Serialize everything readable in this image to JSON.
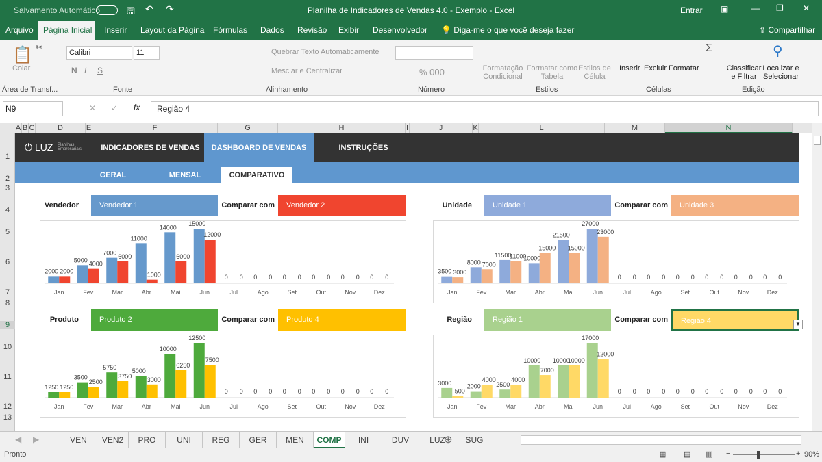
{
  "titlebar": {
    "autosave": "Salvamento Automático",
    "title": "Planilha de Indicadores de Vendas 4.0 - Exemplo - Excel",
    "signin": "Entrar"
  },
  "ribbon_tabs": [
    "Arquivo",
    "Página Inicial",
    "Inserir",
    "Layout da Página",
    "Fórmulas",
    "Dados",
    "Revisão",
    "Exibir",
    "Desenvolvedor"
  ],
  "tell_me": "Diga-me o que você deseja fazer",
  "share": "Compartilhar",
  "ribbon": {
    "paste": "Colar",
    "font_name": "Calibri",
    "font_size": "11",
    "wrap": "Quebrar Texto Automaticamente",
    "merge": "Mesclar e Centralizar",
    "cond_format": "Formatação Condicional",
    "format_table": "Formatar como Tabela",
    "cell_styles": "Estilos de Célula",
    "insert": "Inserir",
    "delete": "Excluir",
    "format": "Formatar",
    "sort": "Classificar e Filtrar",
    "find": "Localizar e Selecionar",
    "groups": [
      "Área de Transf...",
      "Fonte",
      "Alinhamento",
      "Número",
      "Estilos",
      "Células",
      "Edição"
    ]
  },
  "formula_bar": {
    "name_box": "N9",
    "content": "Região 4"
  },
  "columns": [
    "A",
    "B",
    "C",
    "D",
    "E",
    "F",
    "G",
    "H",
    "I",
    "J",
    "K",
    "L",
    "M",
    "N"
  ],
  "rows": [
    "1",
    "2",
    "3",
    "4",
    "5",
    "6",
    "7",
    "8",
    "9",
    "10",
    "11",
    "12",
    "13"
  ],
  "dashboard": {
    "logo": "LUZ",
    "logo_sub": "Planilhas Empresariais",
    "nav": [
      "INDICADORES DE VENDAS",
      "DASHBOARD DE VENDAS",
      "INSTRUÇÕES"
    ],
    "subnav": [
      "GERAL",
      "MENSAL",
      "COMPARATIVO"
    ],
    "compare_label": "Comparar com"
  },
  "panels": [
    {
      "label": "Vendedor",
      "a": "Vendedor 1",
      "b": "Vendedor 2",
      "color_a": "#6699cc",
      "color_b": "#f0452f"
    },
    {
      "label": "Unidade",
      "a": "Unidade 1",
      "b": "Unidade 3",
      "color_a": "#8eaadb",
      "color_b": "#f4b183"
    },
    {
      "label": "Produto",
      "a": "Produto 2",
      "b": "Produto 4",
      "color_a": "#4eaa3c",
      "color_b": "#ffc000"
    },
    {
      "label": "Região",
      "a": "Região 1",
      "b": "Região 4",
      "color_a": "#a9d18e",
      "color_b": "#ffd966"
    }
  ],
  "chart_data": [
    {
      "type": "bar",
      "categories": [
        "Jan",
        "Fev",
        "Mar",
        "Abr",
        "Mai",
        "Jun",
        "Jul",
        "Ago",
        "Set",
        "Out",
        "Nov",
        "Dez"
      ],
      "series": [
        {
          "name": "Vendedor 1",
          "values": [
            2000,
            5000,
            7000,
            11000,
            14000,
            15000,
            0,
            0,
            0,
            0,
            0,
            0
          ]
        },
        {
          "name": "Vendedor 2",
          "values": [
            2000,
            4000,
            6000,
            1000,
            6000,
            12000,
            0,
            0,
            0,
            0,
            0,
            0
          ]
        }
      ]
    },
    {
      "type": "bar",
      "categories": [
        "Jan",
        "Fev",
        "Mar",
        "Abr",
        "Mai",
        "Jun",
        "Jul",
        "Ago",
        "Set",
        "Out",
        "Nov",
        "Dez"
      ],
      "series": [
        {
          "name": "Unidade 1",
          "values": [
            3500,
            8000,
            11500,
            10000,
            21500,
            27000,
            0,
            0,
            0,
            0,
            0,
            0
          ]
        },
        {
          "name": "Unidade 3",
          "values": [
            3000,
            7000,
            11000,
            15000,
            15000,
            23000,
            0,
            0,
            0,
            0,
            0,
            0
          ]
        }
      ]
    },
    {
      "type": "bar",
      "categories": [
        "Jan",
        "Fev",
        "Mar",
        "Abr",
        "Mai",
        "Jun",
        "Jul",
        "Ago",
        "Set",
        "Out",
        "Nov",
        "Dez"
      ],
      "series": [
        {
          "name": "Produto 2",
          "values": [
            1250,
            3500,
            5750,
            5000,
            10000,
            12500,
            0,
            0,
            0,
            0,
            0,
            0
          ]
        },
        {
          "name": "Produto 4",
          "values": [
            1250,
            2500,
            3750,
            3000,
            6250,
            7500,
            0,
            0,
            0,
            0,
            0,
            0
          ]
        }
      ]
    },
    {
      "type": "bar",
      "categories": [
        "Jan",
        "Fev",
        "Mar",
        "Abr",
        "Mai",
        "Jun",
        "Jul",
        "Ago",
        "Set",
        "Out",
        "Nov",
        "Dez"
      ],
      "series": [
        {
          "name": "Região 1",
          "values": [
            3000,
            2000,
            2500,
            10000,
            10000,
            17000,
            0,
            0,
            0,
            0,
            0,
            0
          ]
        },
        {
          "name": "Região 4",
          "values": [
            500,
            4000,
            4000,
            7000,
            10000,
            12000,
            0,
            0,
            0,
            0,
            0,
            0
          ]
        }
      ]
    }
  ],
  "sheet_tabs": [
    "VEN",
    "VEN2",
    "PRO",
    "UNI",
    "REG",
    "GER",
    "MEN",
    "COMP",
    "INI",
    "DUV",
    "LUZ",
    "SUG"
  ],
  "active_sheet": "COMP",
  "status": {
    "ready": "Pronto",
    "zoom": "90%"
  }
}
